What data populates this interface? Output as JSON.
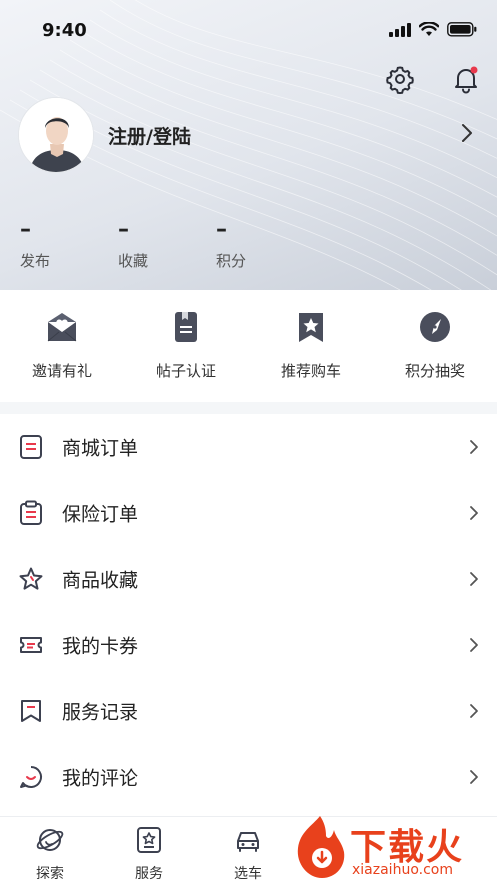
{
  "status_bar": {
    "time": "9:40"
  },
  "profile": {
    "name": "注册/登陆"
  },
  "stats": [
    {
      "value": "–",
      "label": "发布"
    },
    {
      "value": "–",
      "label": "收藏"
    },
    {
      "value": "–",
      "label": "积分"
    }
  ],
  "quick_actions": [
    {
      "label": "邀请有礼",
      "icon": "invite-mail-icon"
    },
    {
      "label": "帖子认证",
      "icon": "post-certify-icon"
    },
    {
      "label": "推荐购车",
      "icon": "recommend-bookmark-icon"
    },
    {
      "label": "积分抽奖",
      "icon": "lottery-compass-icon"
    }
  ],
  "menu": [
    {
      "label": "商城订单",
      "icon": "order-doc-icon"
    },
    {
      "label": "保险订单",
      "icon": "clipboard-icon"
    },
    {
      "label": "商品收藏",
      "icon": "star-icon"
    },
    {
      "label": "我的卡券",
      "icon": "coupon-icon"
    },
    {
      "label": "服务记录",
      "icon": "bookmark-icon"
    },
    {
      "label": "我的评论",
      "icon": "comment-icon"
    }
  ],
  "tabbar": [
    {
      "label": "探索",
      "icon": "explore-planet-icon"
    },
    {
      "label": "服务",
      "icon": "service-icon"
    },
    {
      "label": "选车",
      "icon": "car-icon"
    }
  ],
  "watermark": {
    "text": "下载火",
    "url": "xiazaihuo.com"
  },
  "colors": {
    "accent": "#e8394c",
    "icon_dark": "#3d4150",
    "brand_orange": "#e8411c"
  }
}
